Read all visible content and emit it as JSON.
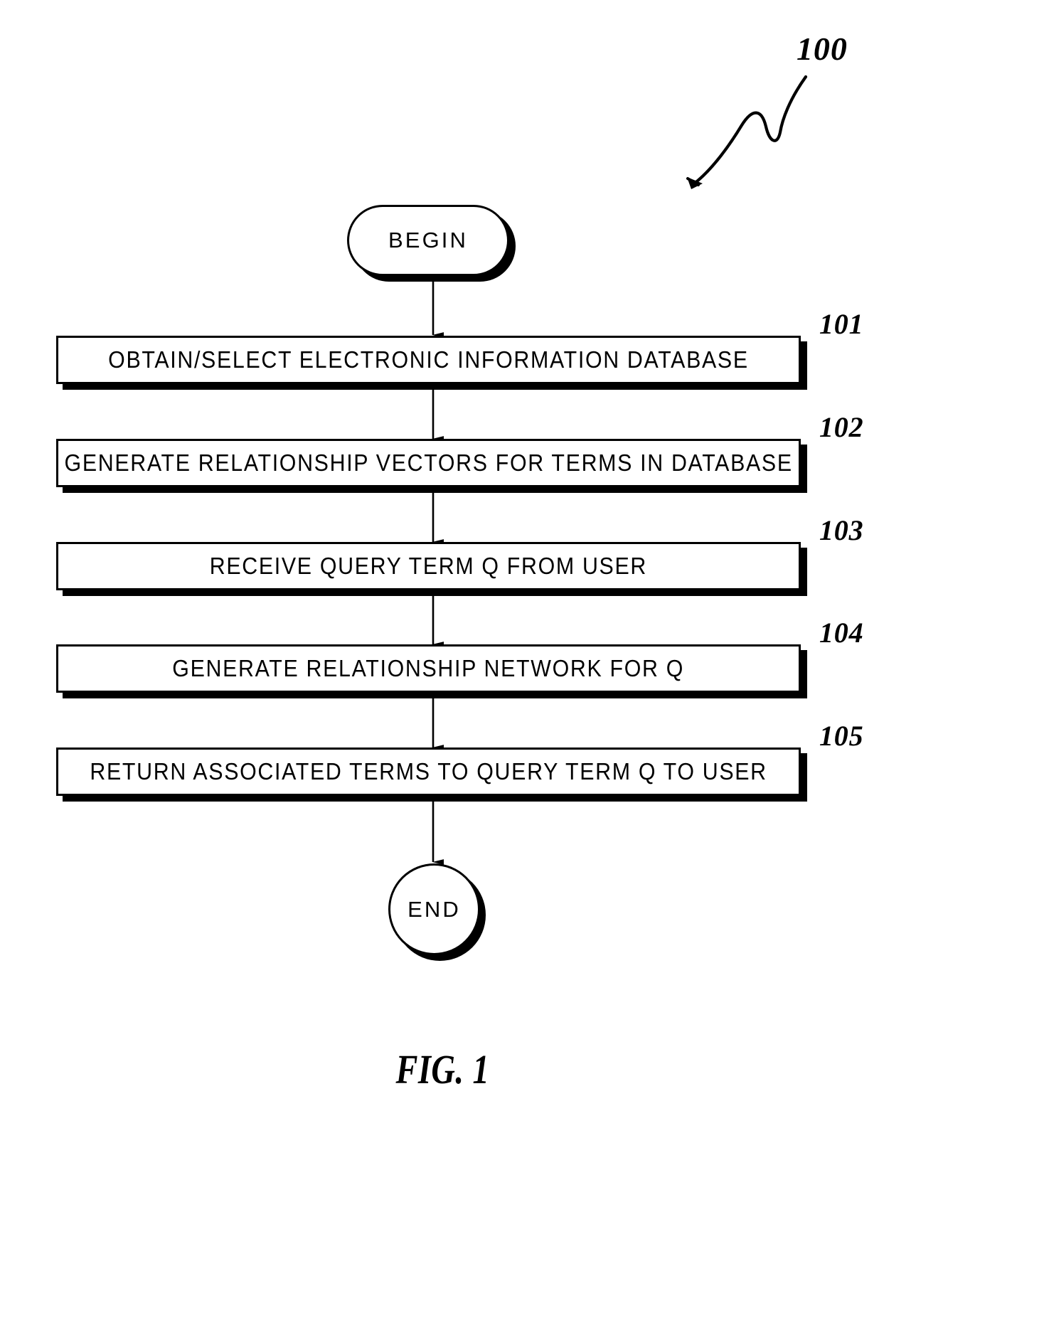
{
  "figure": {
    "caption": "FIG. 1",
    "reference_numeral": "100"
  },
  "flowchart": {
    "start_node": {
      "label": "BEGIN",
      "shape": "stadium"
    },
    "end_node": {
      "label": "END",
      "shape": "circle"
    },
    "steps": [
      {
        "ref": "101",
        "label": "OBTAIN/SELECT ELECTRONIC INFORMATION DATABASE"
      },
      {
        "ref": "102",
        "label": "GENERATE RELATIONSHIP VECTORS FOR TERMS IN DATABASE"
      },
      {
        "ref": "103",
        "label": "RECEIVE QUERY TERM Q FROM USER"
      },
      {
        "ref": "104",
        "label": "GENERATE RELATIONSHIP NETWORK FOR Q"
      },
      {
        "ref": "105",
        "label": "RETURN ASSOCIATED TERMS TO QUERY TERM Q TO USER"
      }
    ]
  },
  "colors": {
    "ink": "#000000",
    "paper": "#ffffff"
  }
}
